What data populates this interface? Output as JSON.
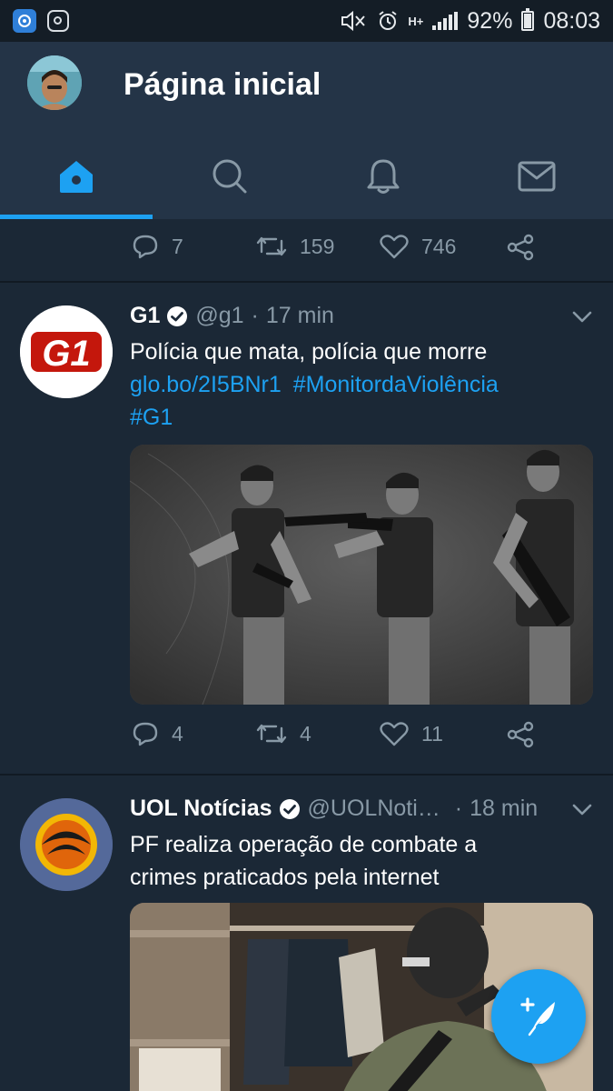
{
  "status_bar": {
    "battery": "92%",
    "time": "08:03",
    "network": "H+"
  },
  "header": {
    "title": "Página inicial"
  },
  "tabs": [
    {
      "name": "home",
      "icon": "home-icon",
      "active": true
    },
    {
      "name": "search",
      "icon": "search-icon",
      "active": false
    },
    {
      "name": "notifications",
      "icon": "bell-icon",
      "active": false
    },
    {
      "name": "messages",
      "icon": "mail-icon",
      "active": false
    }
  ],
  "feed": {
    "previous_tweet": {
      "replies": "7",
      "retweets": "159",
      "likes": "746"
    },
    "tweets": [
      {
        "name": "G1",
        "handle": "@g1",
        "separator": "·",
        "time": "17 min",
        "text": "Polícia que mata, polícia que morre",
        "link": "glo.bo/2I5BNr1",
        "hashtag1": "#MonitordaViolência",
        "hashtag2": "#G1",
        "avatar_logo": "G1",
        "replies": "4",
        "retweets": "4",
        "likes": "11"
      },
      {
        "name": "UOL Notícias",
        "handle": "@UOLNoti…",
        "separator": "·",
        "time": "18 min",
        "text_line1": "PF realiza operação de combate a",
        "text_line2": "crimes praticados pela internet"
      }
    ]
  },
  "colors": {
    "background": "#1b2836",
    "header": "#243447",
    "accent": "#1da1f2",
    "muted": "#8899a6",
    "g1_red": "#c4170c"
  }
}
